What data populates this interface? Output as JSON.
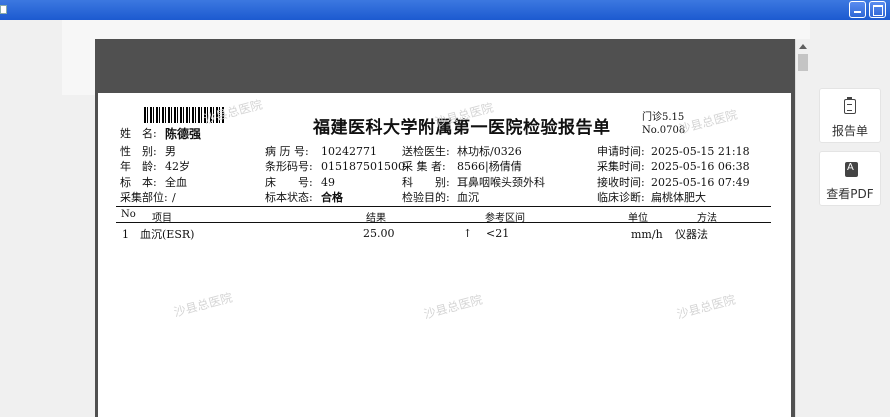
{
  "window": {
    "title": ""
  },
  "report": {
    "title": "福建医科大学附属第一医院检验报告单",
    "clinic_code": "门诊5.15",
    "report_no": "No.0708",
    "watermark": "沙县总医院",
    "patient": {
      "name_label": "姓　名:",
      "name": "陈德强",
      "gender_label": "性　别:",
      "gender": "男",
      "age_label": "年　龄:",
      "age": "42岁",
      "specimen_label": "标　本:",
      "specimen": "全血",
      "site_label": "采集部位:",
      "site": "/"
    },
    "record": {
      "case_no_label": "病 历 号:",
      "case_no": "10242771",
      "barcode_label": "条形码号:",
      "barcode": "015187501500",
      "bed_label": "床　　号:",
      "bed": "49",
      "status_label": "标本状态:",
      "status": "合格"
    },
    "doctor": {
      "sender_label": "送检医生:",
      "sender": "林功标/0326",
      "collector_label": "采 集 者:",
      "collector": "8566|杨倩倩",
      "dept_label": "科　　别:",
      "dept": "耳鼻咽喉头颈外科",
      "purpose_label": "检验目的:",
      "purpose": "血沉"
    },
    "times": {
      "apply_label": "申请时间:",
      "apply": "2025-05-15 21:18",
      "collect_label": "采集时间:",
      "collect": "2025-05-16 06:38",
      "receive_label": "接收时间:",
      "receive": "2025-05-16 07:49",
      "diagnosis_label": "临床诊断:",
      "diagnosis": "扁桃体肥大"
    },
    "table": {
      "headers": {
        "no": "No",
        "item": "项目",
        "result": "结果",
        "range": "参考区间",
        "unit": "单位",
        "method": "方法"
      },
      "rows": [
        {
          "no": "1",
          "item": "血沉(ESR)",
          "result": "25.00",
          "flag": "↑",
          "range": "<21",
          "unit": "mm/h",
          "method": "仪器法"
        }
      ]
    }
  },
  "sidebar": {
    "report_label": "报告单",
    "pdf_label": "查看PDF",
    "report_icon": "clipboard-icon",
    "pdf_icon": "pdf-icon"
  }
}
